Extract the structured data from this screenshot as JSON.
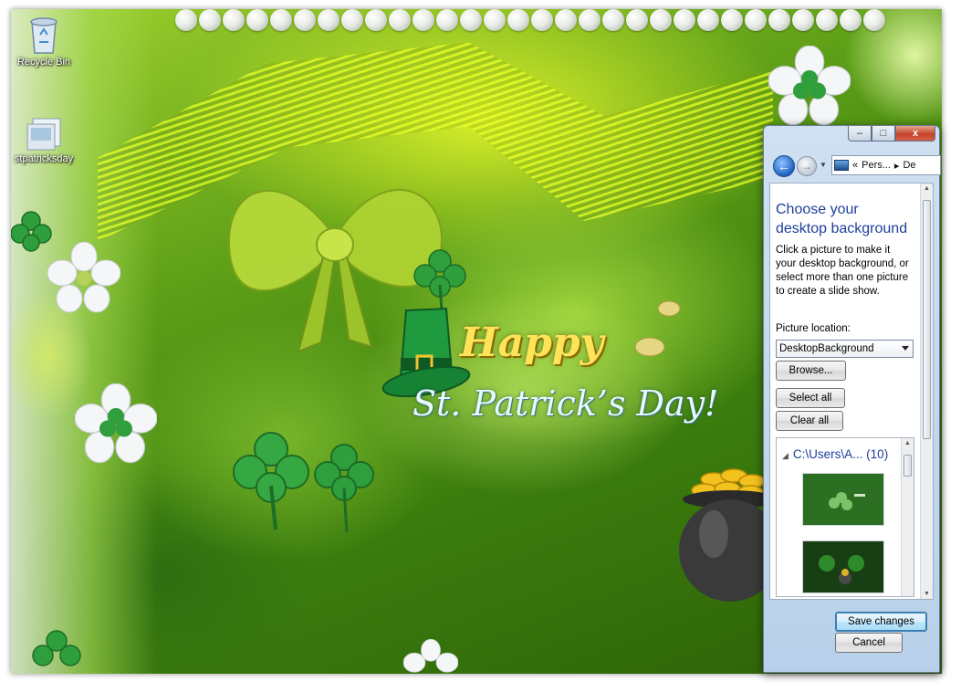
{
  "desktop": {
    "greeting_line1": "Happy",
    "greeting_line2": "St. Patrick’s Day!",
    "icons": [
      {
        "label": "Recycle Bin",
        "icon": "recycle-bin-icon"
      },
      {
        "label": "stpatricksday",
        "icon": "theme-file-icon"
      }
    ]
  },
  "window": {
    "caption_buttons": {
      "minimize": "–",
      "maximize": "□",
      "close": "x"
    },
    "nav": {
      "back": "←",
      "forward": "→",
      "history": "▼",
      "address_prefix": "«",
      "address_crumb1": "Pers...",
      "address_sep": "▸",
      "address_crumb2": "De"
    },
    "heading": "Choose your desktop background",
    "description": "Click a picture to make it your desktop background, or select more than one picture to create a slide show.",
    "picture_location_label": "Picture location:",
    "picture_location_value": "DesktopBackground",
    "browse_label": "Browse...",
    "select_all_label": "Select all",
    "clear_all_label": "Clear all",
    "group_header": "C:\\Users\\A... (10)",
    "save_label": "Save changes",
    "cancel_label": "Cancel"
  },
  "colors": {
    "accent_blue": "#1e3f99",
    "desktop_green": "#5c9e17",
    "greeting_gold": "#ffe45a"
  }
}
